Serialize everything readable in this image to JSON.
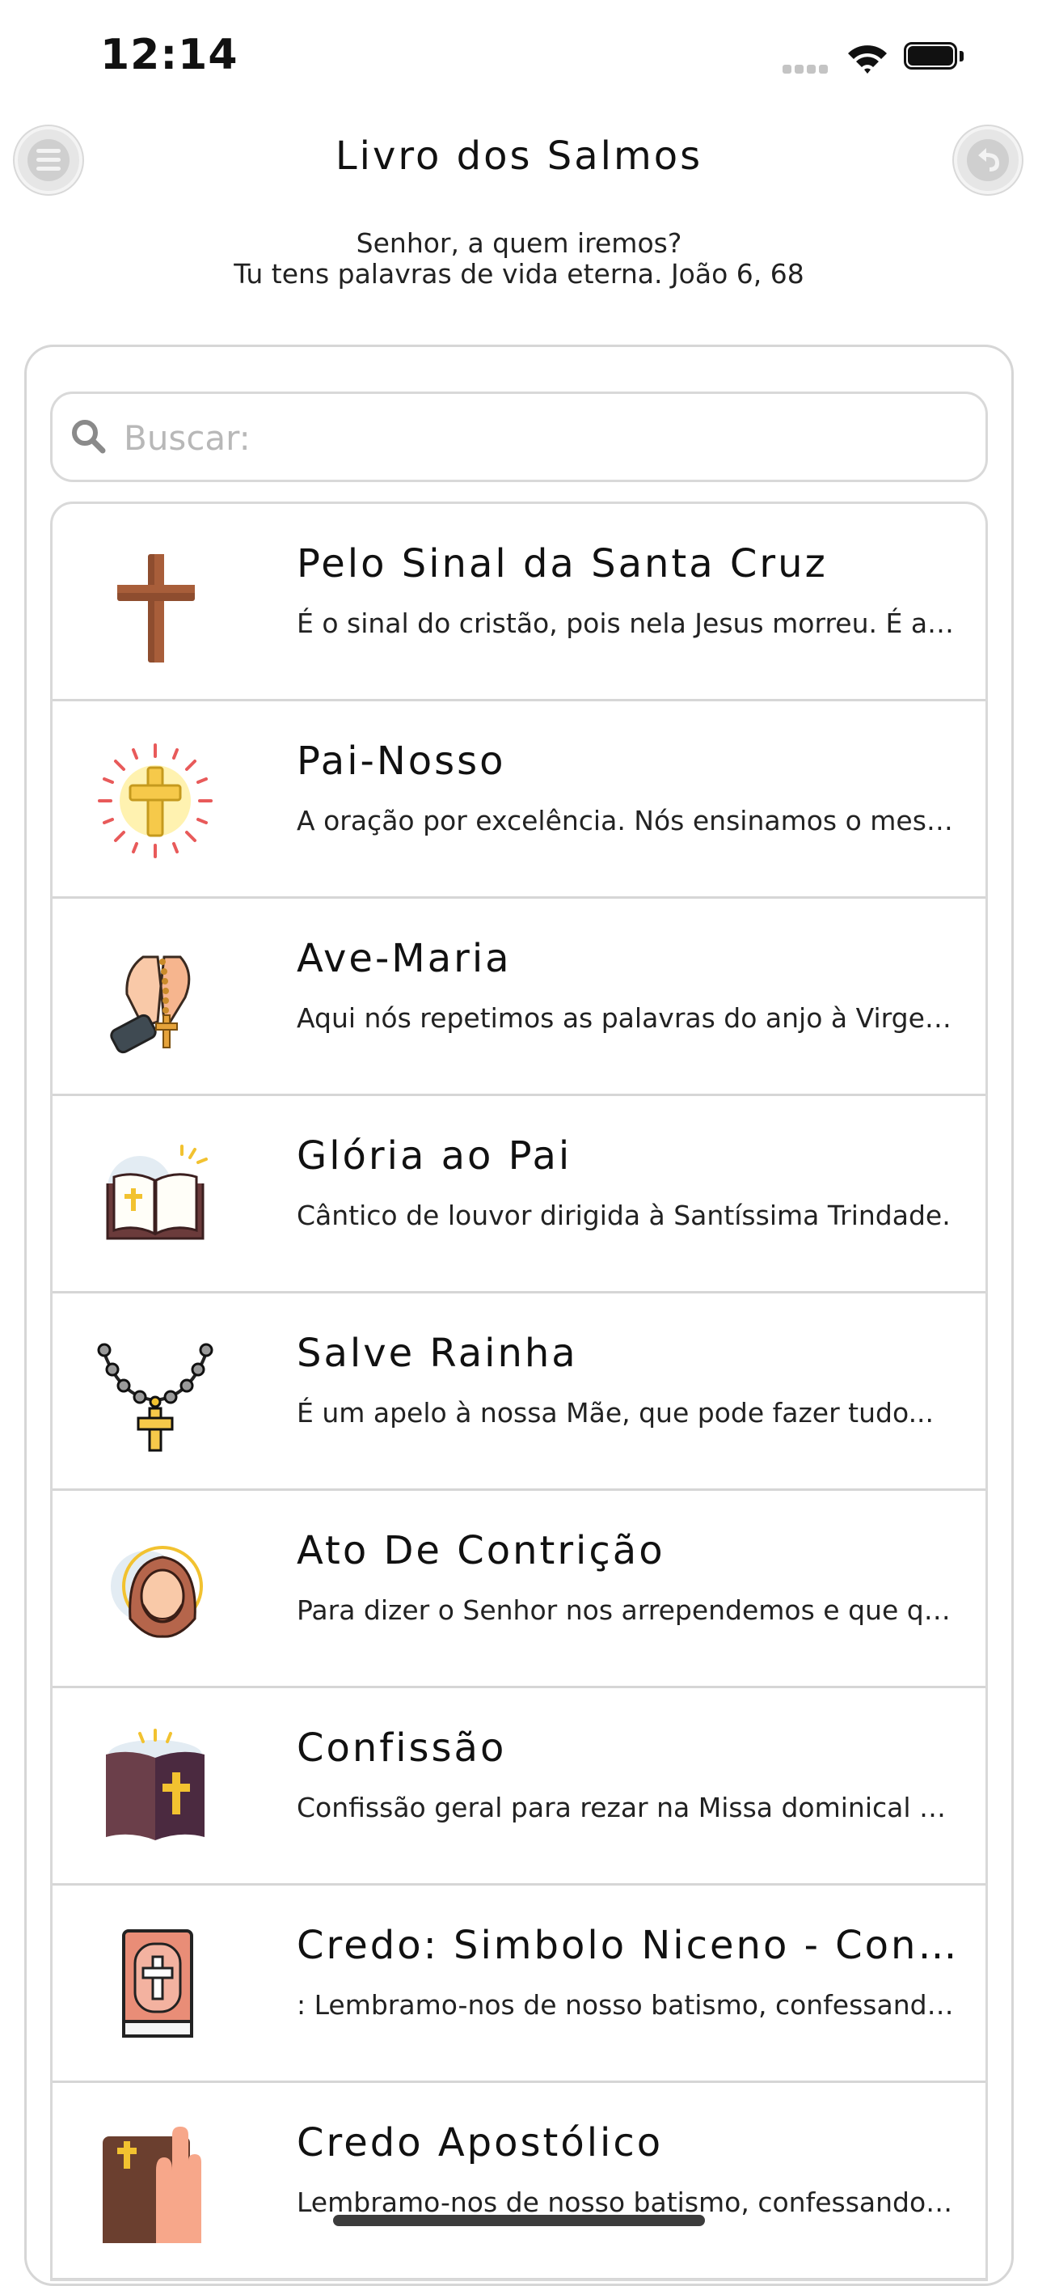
{
  "status_bar": {
    "time": "12:14"
  },
  "header": {
    "title": "Livro dos Salmos",
    "subtitle_line1": "Senhor, a quem iremos?",
    "subtitle_line2": "Tu tens palavras de vida eterna. João 6, 68"
  },
  "search": {
    "placeholder": "Buscar:",
    "value": ""
  },
  "prayers": [
    {
      "title": "Pelo Sinal da Santa Cruz",
      "desc": "É o sinal do cristão, pois nela Jesus morreu. É a nossa proteção.",
      "icon": "cross-icon"
    },
    {
      "title": "Pai-Nosso",
      "desc": "A oração por excelência. Nós ensinamos o mesmo que Jesus ensinou.",
      "icon": "radiant-cross-icon"
    },
    {
      "title": "Ave-Maria",
      "desc": "Aqui nós repetimos as palavras do anjo à Virgem Maria.",
      "icon": "praying-hands-rosary-icon"
    },
    {
      "title": "Glória ao Pai",
      "desc": "Cântico de louvor dirigida à Santíssima Trindade.",
      "icon": "open-bible-icon"
    },
    {
      "title": "Salve Rainha",
      "desc": "É um apelo à nossa Mãe, que pode fazer tudo...",
      "icon": "rosary-icon"
    },
    {
      "title": "Ato De Contrição",
      "desc": "Para dizer o Senhor nos arrependemos e que queremos mudar.",
      "icon": "jesus-face-icon"
    },
    {
      "title": "Confissão",
      "desc": "Confissão geral para rezar na Missa dominical e outras ocasiões.",
      "icon": "holy-book-icon"
    },
    {
      "title": "Credo: Simbolo Niceno - Constantinopolitano",
      "desc": ": Lembramo-nos de nosso batismo, confessando nossa fé.",
      "icon": "bible-cross-icon"
    },
    {
      "title": "Credo Apostólico",
      "desc": "Lembramo-nos de nosso batismo, confessando nossa fé.",
      "icon": "hand-on-bible-icon"
    }
  ]
}
